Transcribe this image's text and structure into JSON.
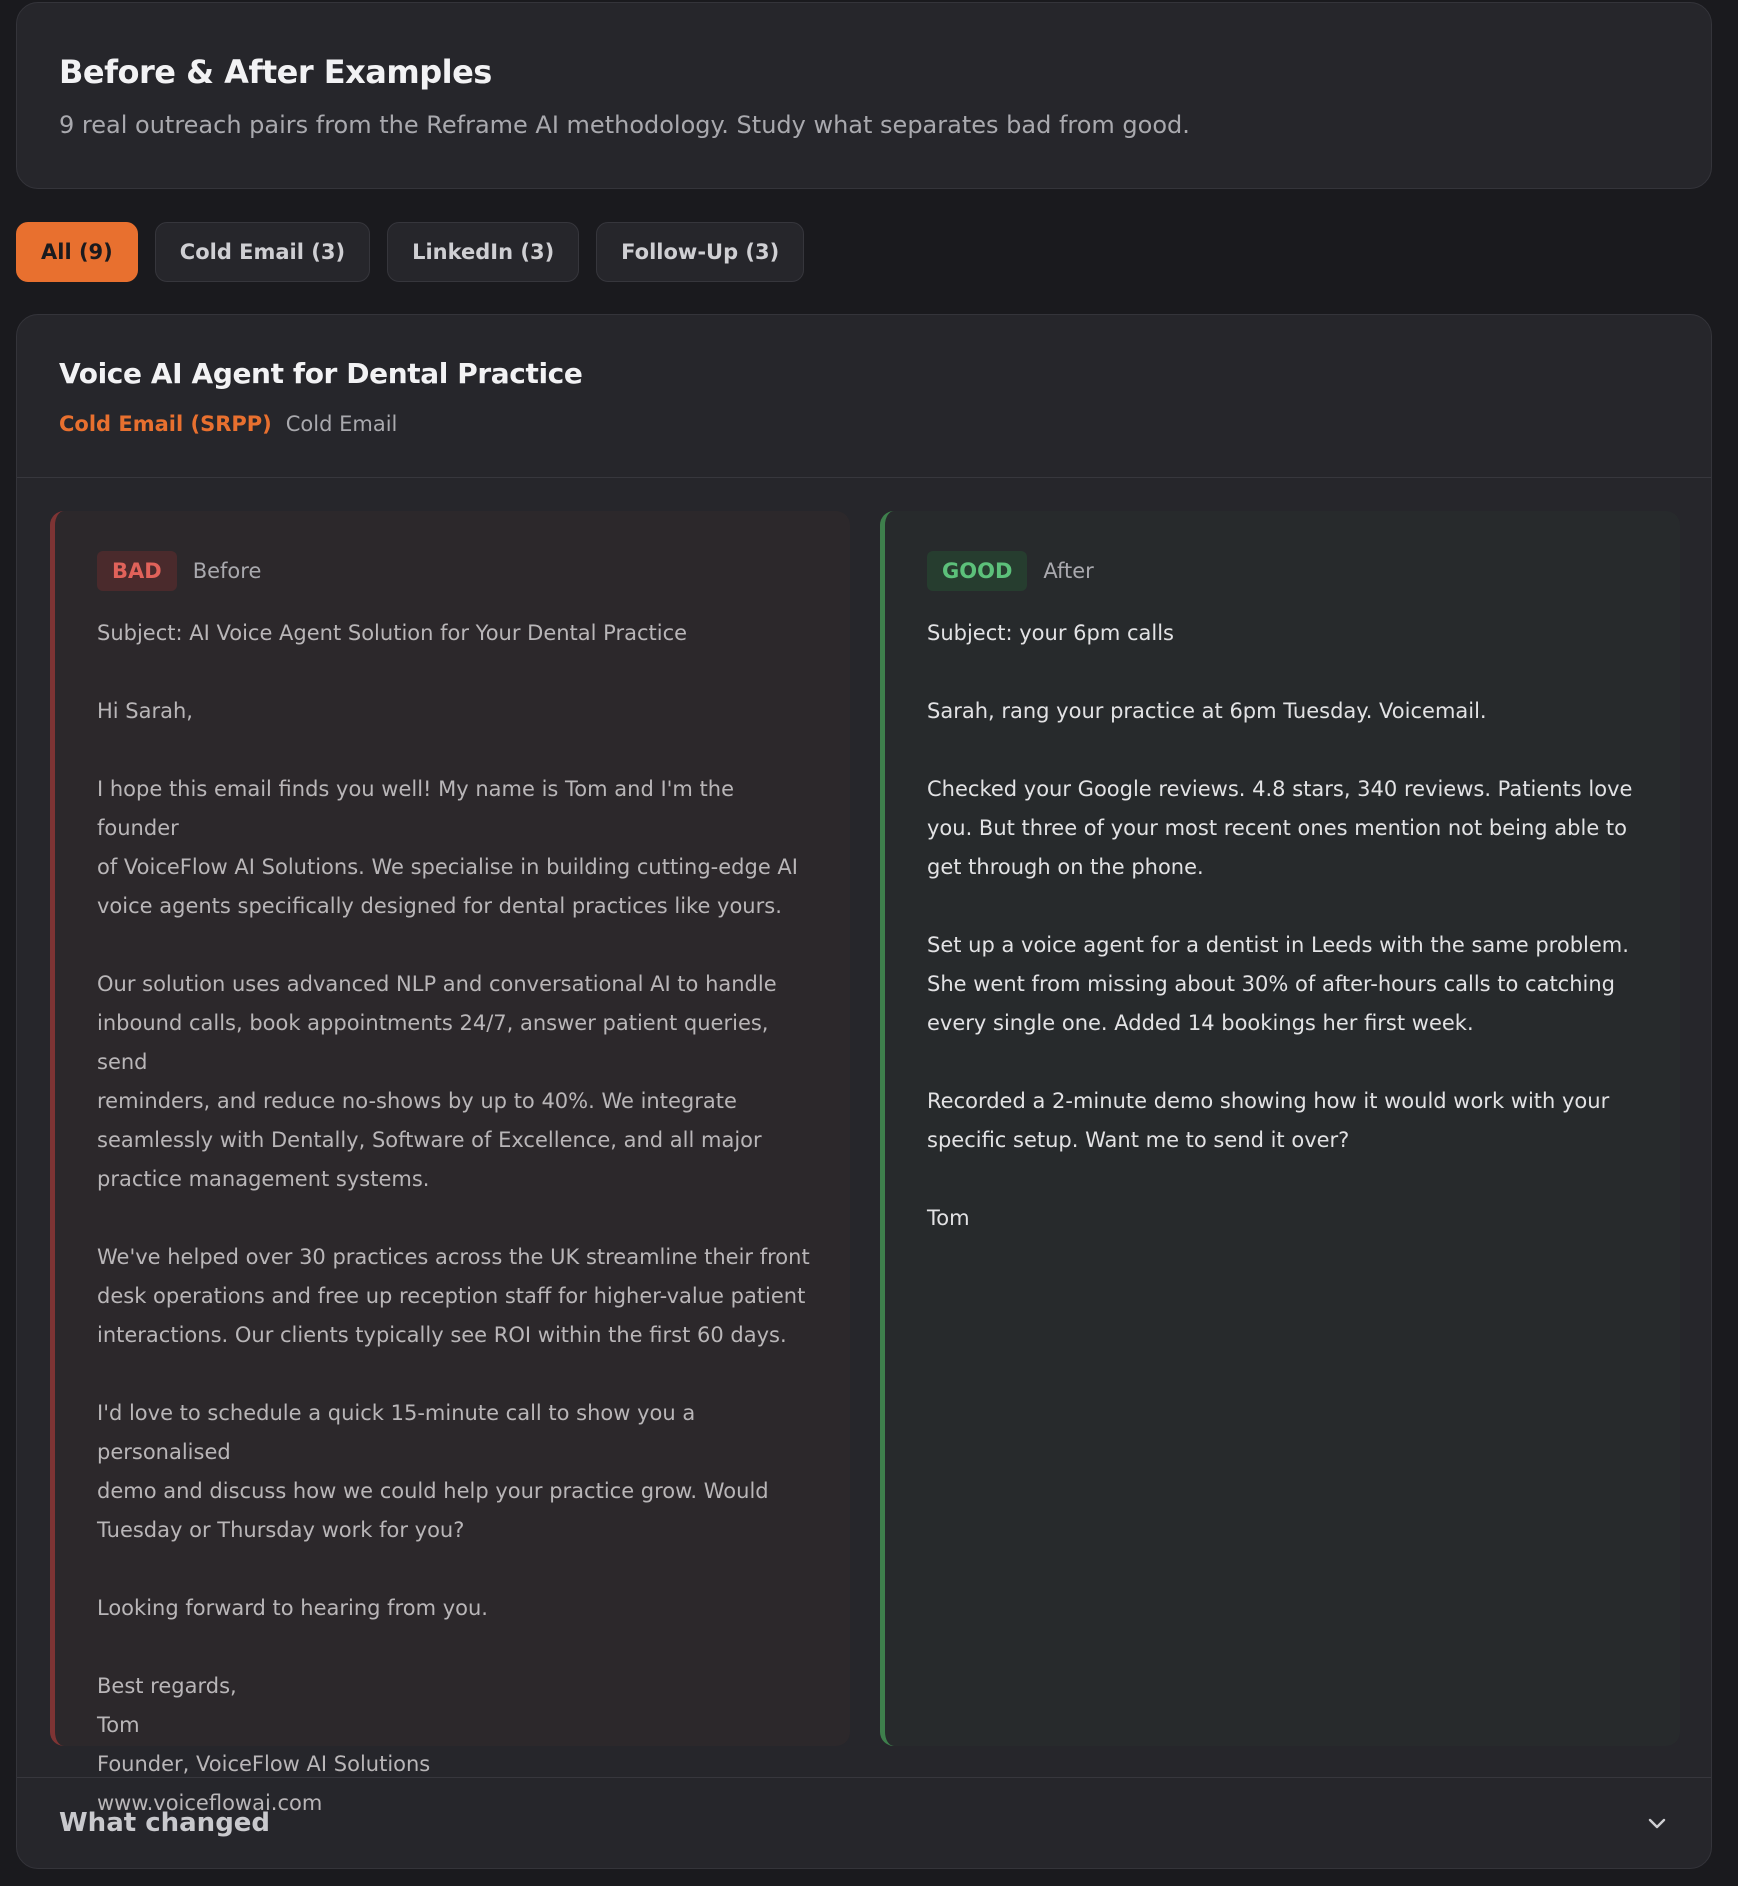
{
  "header": {
    "title": "Before & After Examples",
    "subtitle": "9 real outreach pairs from the Reframe AI methodology. Study what separates bad from good."
  },
  "filters": [
    {
      "label": "All (9)",
      "active": true
    },
    {
      "label": "Cold Email (3)",
      "active": false
    },
    {
      "label": "LinkedIn (3)",
      "active": false
    },
    {
      "label": "Follow-Up (3)",
      "active": false
    }
  ],
  "example": {
    "title": "Voice AI Agent for Dental Practice",
    "tag": "Cold Email (SRPP)",
    "type": "Cold Email",
    "bad": {
      "badge": "BAD",
      "label": "Before",
      "text": "Subject: AI Voice Agent Solution for Your Dental Practice\n\nHi Sarah,\n\nI hope this email finds you well! My name is Tom and I'm the founder\nof VoiceFlow AI Solutions. We specialise in building cutting-edge AI\nvoice agents specifically designed for dental practices like yours.\n\nOur solution uses advanced NLP and conversational AI to handle\ninbound calls, book appointments 24/7, answer patient queries, send\nreminders, and reduce no-shows by up to 40%. We integrate\nseamlessly with Dentally, Software of Excellence, and all major\npractice management systems.\n\nWe've helped over 30 practices across the UK streamline their front\ndesk operations and free up reception staff for higher-value patient\ninteractions. Our clients typically see ROI within the first 60 days.\n\nI'd love to schedule a quick 15-minute call to show you a personalised\ndemo and discuss how we could help your practice grow. Would\nTuesday or Thursday work for you?\n\nLooking forward to hearing from you.\n\nBest regards,\nTom\nFounder, VoiceFlow AI Solutions\nwww.voiceflowai.com"
    },
    "good": {
      "badge": "GOOD",
      "label": "After",
      "text": "Subject: your 6pm calls\n\nSarah, rang your practice at 6pm Tuesday. Voicemail.\n\nChecked your Google reviews. 4.8 stars, 340 reviews. Patients love\nyou. But three of your most recent ones mention not being able to\nget through on the phone.\n\nSet up a voice agent for a dentist in Leeds with the same problem.\nShe went from missing about 30% of after-hours calls to catching\nevery single one. Added 14 bookings her first week.\n\nRecorded a 2-minute demo showing how it would work with your\nspecific setup. Want me to send it over?\n\nTom"
    },
    "what_changed_label": "What changed"
  }
}
